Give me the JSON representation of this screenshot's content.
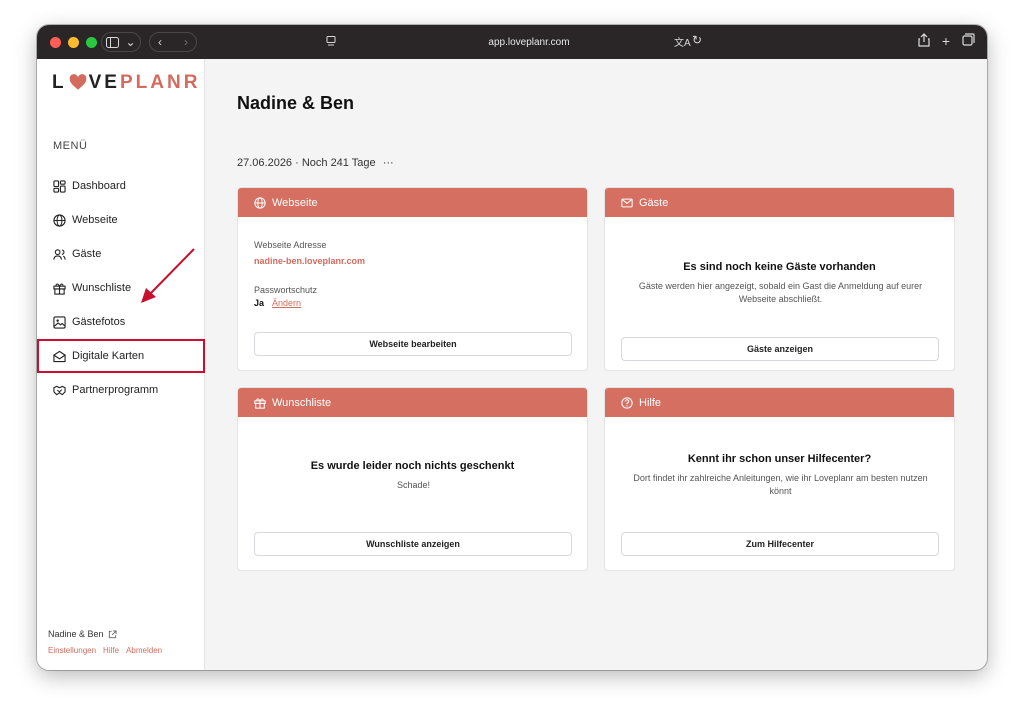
{
  "browser": {
    "url": "app.loveplanr.com",
    "colors": {
      "close": "#ff5f57",
      "minimize": "#febc2e",
      "zoom": "#28c840"
    }
  },
  "logo": {
    "part1": "L",
    "part2": "VE",
    "part3": "PLANR"
  },
  "sidebar": {
    "menu_label": "MENÜ",
    "items": [
      {
        "label": "Dashboard",
        "icon": "dashboard-icon"
      },
      {
        "label": "Webseite",
        "icon": "globe-icon"
      },
      {
        "label": "Gäste",
        "icon": "users-icon"
      },
      {
        "label": "Wunschliste",
        "icon": "gift-icon"
      },
      {
        "label": "Gästefotos",
        "icon": "image-icon"
      },
      {
        "label": "Digitale Karten",
        "icon": "envelope-open-icon"
      },
      {
        "label": "Partnerprogramm",
        "icon": "handshake-icon"
      }
    ],
    "footer": {
      "user": "Nadine & Ben",
      "links": [
        "Einstellungen",
        "Hilfe",
        "Abmelden"
      ]
    }
  },
  "main": {
    "title": "Nadine & Ben",
    "subline": "27.06.2026 · Noch 241 Tage",
    "more": "···",
    "cards": {
      "webseite": {
        "title": "Webseite",
        "address_label": "Webseite Adresse",
        "address_value": "nadine-ben.loveplanr.com",
        "password_label": "Passwortschutz",
        "password_value": "Ja",
        "password_change": "Ändern",
        "button": "Webseite bearbeiten"
      },
      "gaeste": {
        "title": "Gäste",
        "heading": "Es sind noch keine Gäste vorhanden",
        "desc": "Gäste werden hier angezeigt, sobald ein Gast die Anmeldung auf eurer Webseite abschließt.",
        "button": "Gäste anzeigen"
      },
      "wunschliste": {
        "title": "Wunschliste",
        "heading": "Es wurde leider noch nichts geschenkt",
        "desc": "Schade!",
        "button": "Wunschliste anzeigen"
      },
      "hilfe": {
        "title": "Hilfe",
        "heading": "Kennt ihr schon unser Hilfecenter?",
        "desc": "Dort findet ihr zahlreiche Anleitungen, wie ihr Loveplanr am besten nutzen könnt",
        "button": "Zum Hilfecenter"
      }
    }
  },
  "theme": {
    "accent": "#d56f62",
    "highlight": "#c8102e"
  }
}
